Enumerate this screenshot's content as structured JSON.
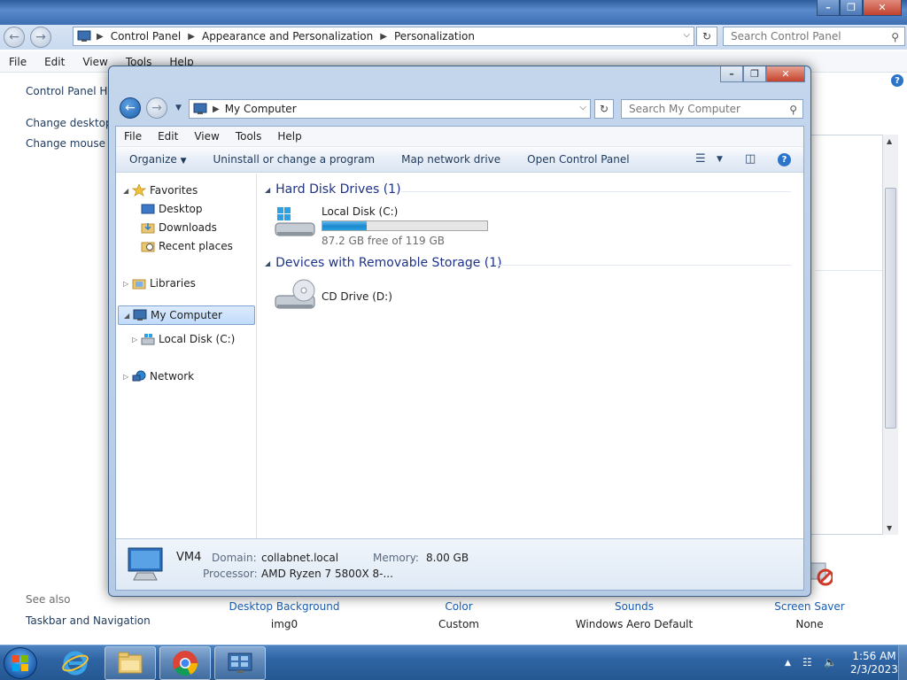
{
  "bg_window": {
    "address": [
      "Control Panel",
      "Appearance and Personalization",
      "Personalization"
    ],
    "search_placeholder": "Search Control Panel",
    "menu": [
      "File",
      "Edit",
      "View",
      "Tools",
      "Help"
    ],
    "left_links": [
      "Control Panel Home",
      "Change desktop icons",
      "Change mouse pointers"
    ],
    "see_also": "See also",
    "see_also_links": [
      "Taskbar and Navigation"
    ],
    "bottom_items": [
      {
        "label": "Desktop Background",
        "value": "img0"
      },
      {
        "label": "Color",
        "value": "Custom"
      },
      {
        "label": "Sounds",
        "value": "Windows Aero Default"
      },
      {
        "label": "Screen Saver",
        "value": "None"
      }
    ]
  },
  "fg_window": {
    "address": "My Computer",
    "search_placeholder": "Search My Computer",
    "menu": [
      "File",
      "Edit",
      "View",
      "Tools",
      "Help"
    ],
    "toolbar": {
      "organize": "Organize",
      "uninstall": "Uninstall or change a program",
      "map_drive": "Map network drive",
      "open_cp": "Open Control Panel"
    },
    "nav": {
      "favorites": "Favorites",
      "desktop": "Desktop",
      "downloads": "Downloads",
      "recent": "Recent places",
      "libraries": "Libraries",
      "my_computer": "My Computer",
      "local_disk": "Local Disk (C:)",
      "network": "Network"
    },
    "groups": {
      "hdd": "Hard Disk Drives (1)",
      "removable": "Devices with Removable Storage (1)"
    },
    "drives": {
      "c_name": "Local Disk (C:)",
      "c_info": "87.2 GB free of 119 GB",
      "c_used_fraction": 0.267,
      "d_name": "CD Drive (D:)"
    },
    "details": {
      "computer_name": "VM4",
      "domain_label": "Domain:",
      "domain_value": "collabnet.local",
      "memory_label": "Memory:",
      "memory_value": "8.00 GB",
      "processor_label": "Processor:",
      "processor_value": "AMD Ryzen 7 5800X 8-..."
    }
  },
  "taskbar": {
    "time": "1:56 AM",
    "date": "2/3/2023",
    "apps": [
      "internet-explorer-icon",
      "file-explorer-icon",
      "chrome-icon",
      "control-panel-icon"
    ]
  },
  "colors": {
    "accent": "#1a5fb4",
    "progress": "#26a0df",
    "header": "#1e3287"
  }
}
